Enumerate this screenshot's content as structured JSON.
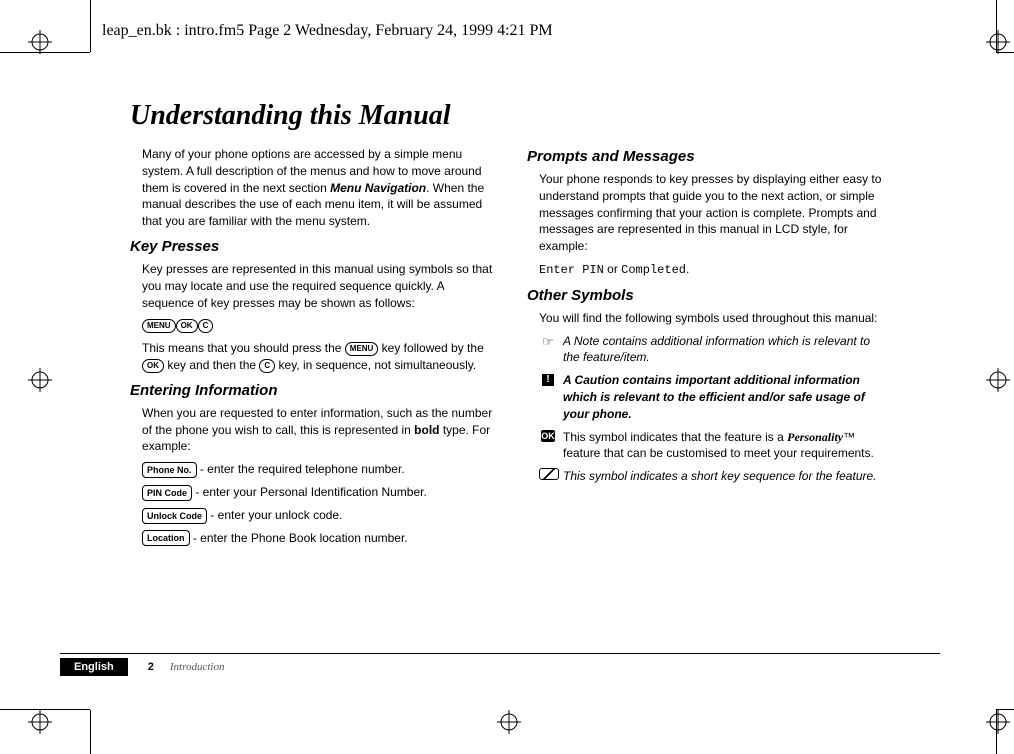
{
  "header": "leap_en.bk : intro.fm5  Page 2  Wednesday, February 24, 1999  4:21 PM",
  "title": "Understanding this Manual",
  "col1": {
    "intro_a": "Many of your phone options are accessed by a simple menu system. A full description of the menus and how to move around them is covered in the next section ",
    "intro_bold": "Menu Navigation",
    "intro_b": ". When the manual describes the use of each menu item, it will be assumed that you are familiar with the menu system.",
    "h_key": "Key Presses",
    "key_desc": "Key presses are represented in this manual using symbols so that you may locate and use the required sequence quickly. A sequence of key presses may be shown as follows:",
    "keys": {
      "menu": "MENU",
      "ok": "OK",
      "c": "C"
    },
    "key_expl_a": "This means that you should press the ",
    "key_expl_b": " key followed by the ",
    "key_expl_c": " key and then the ",
    "key_expl_d": " key, in sequence, not simultaneously.",
    "h_enter": "Entering Information",
    "enter_desc_a": "When you are requested to enter information, such as the number of the phone you wish to call, this is represented in ",
    "enter_desc_bold": "bold",
    "enter_desc_b": " type. For example:",
    "rows": [
      {
        "label": "Phone No.",
        "text": " - enter the required telephone number."
      },
      {
        "label": "PIN Code",
        "text": " - enter your Personal Identification Number."
      },
      {
        "label": "Unlock Code",
        "text": " - enter your unlock code."
      },
      {
        "label": "Location",
        "text": " - enter the Phone Book location number."
      }
    ]
  },
  "col2": {
    "h_prompts": "Prompts and Messages",
    "prompts_desc": "Your phone responds to key presses by displaying either easy to understand prompts that guide you to the next action, or simple messages confirming that your action is complete. Prompts and messages are represented in this manual in LCD style, for example:",
    "lcd_a": "Enter PIN",
    "lcd_or": " or ",
    "lcd_b": "Completed",
    "h_other": "Other Symbols",
    "other_intro": "You will find the following symbols used throughout this manual:",
    "note": "A Note contains additional information which is relevant to the feature/item.",
    "caution": "A Caution contains important additional information which is relevant to the efficient and/or safe usage of your phone.",
    "ok_a": "This symbol indicates that the feature is a ",
    "ok_bold": "Personality",
    "ok_tm": "™",
    "ok_b": " feature that can be customised to meet your requirements.",
    "short": "This symbol indicates a short key sequence for the feature."
  },
  "footer": {
    "lang": "English",
    "page": "2",
    "section": "Introduction"
  }
}
